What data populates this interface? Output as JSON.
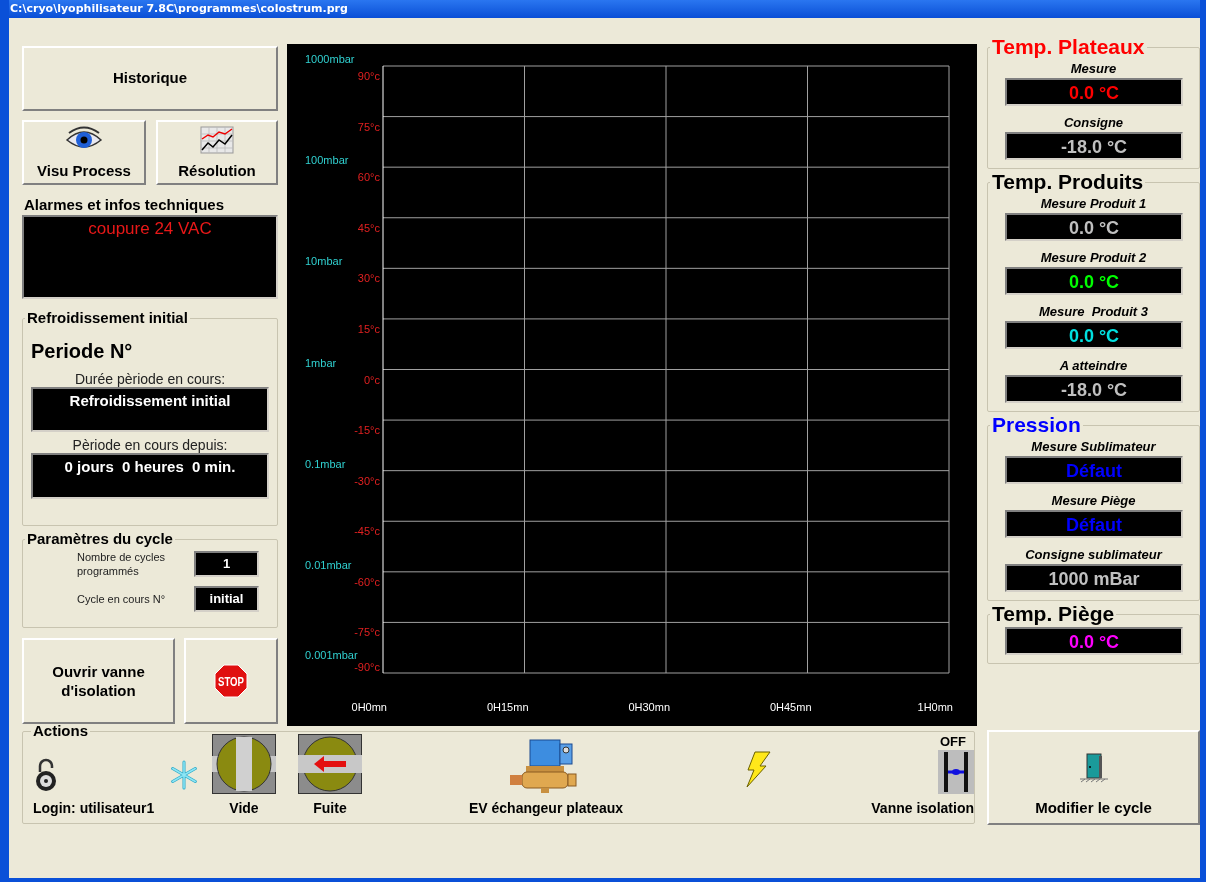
{
  "window": {
    "title": "C:\\cryo\\lyophilisateur 7.8C\\programmes\\colostrum.prg"
  },
  "top_buttons": {
    "history": "Historique",
    "visu_process": "Visu Process",
    "resolution": "Résolution"
  },
  "alarms": {
    "title": "Alarmes et infos techniques",
    "messages": [
      "coupure 24 VAC"
    ]
  },
  "period": {
    "title": "Refroidissement initial",
    "heading": "Periode N°",
    "duration_label": "Durée pèriode en cours:",
    "duration_value": "Refroidissement initial",
    "since_label": "Pèriode en cours depuis:",
    "since_value": "0 jours  0 heures  0 min."
  },
  "cycle_params": {
    "title": "Paramètres du cycle",
    "rows": [
      {
        "label": "Nombre de cycles programmés",
        "value": "1"
      },
      {
        "label": "Cycle en cours N°",
        "value": "initial"
      }
    ]
  },
  "bottom_buttons": {
    "isolation": "Ouvrir vanne d'isolation",
    "stop": "STOP"
  },
  "chart": {
    "temperature_ticks": [
      "90°c",
      "75°c",
      "60°c",
      "45°c",
      "30°c",
      "15°c",
      "0°c",
      "-15°c",
      "-30°c",
      "-45°c",
      "-60°c",
      "-75°c",
      "-90°c"
    ],
    "pressure_ticks": [
      "1000mbar",
      "100mbar",
      "10mbar",
      "1mbar",
      "0.1mbar",
      "0.01mbar",
      "0.001mbar"
    ],
    "time_ticks": [
      "0H0mn",
      "0H15mn",
      "0H30mn",
      "0H45mn",
      "1H0mn"
    ]
  },
  "right_panels": [
    {
      "title": "Temp. Plateaux",
      "color": "#ff0000",
      "readings": [
        {
          "label": "Mesure",
          "value": "0.0 °C",
          "color": "#ff0000"
        },
        {
          "label": "Consigne",
          "value": "-18.0 °C",
          "color": "#c0c0c0"
        }
      ]
    },
    {
      "title": "Temp. Produits",
      "color": "#000000",
      "readings": [
        {
          "label": "Mesure Produit 1",
          "value": "0.0 °C",
          "color": "#c0c0c0"
        },
        {
          "label": "Mesure Produit 2",
          "value": "0.0 °C",
          "color": "#00ff00"
        },
        {
          "label": "Mesure  Produit 3",
          "value": "0.0 °C",
          "color": "#00e0e0"
        },
        {
          "label": "A atteindre",
          "value": "-18.0 °C",
          "color": "#c0c0c0"
        }
      ]
    },
    {
      "title": "Pression",
      "color": "#0000ff",
      "readings": [
        {
          "label": "Mesure Sublimateur",
          "value": "Défaut",
          "color": "#0000ff"
        },
        {
          "label": "Mesure Piège",
          "value": "Défaut",
          "color": "#0000ff"
        },
        {
          "label": "Consigne sublimateur",
          "value": "1000 mBar",
          "color": "#c0c0c0"
        }
      ]
    },
    {
      "title": "Temp. Piège",
      "color": "#000000",
      "readings": [
        {
          "value": "0.0 °C",
          "color": "#ff00ff"
        }
      ]
    }
  ],
  "actions": {
    "title": "Actions",
    "items": [
      {
        "kind": "lock",
        "label": "Login: utilisateur1"
      },
      {
        "kind": "snowflake"
      },
      {
        "kind": "vacuum",
        "label": "Vide"
      },
      {
        "kind": "leak",
        "label": "Fuite"
      },
      {
        "kind": "solenoid",
        "label": "EV échangeur plateaux"
      },
      {
        "kind": "lightning"
      },
      {
        "kind": "isolation",
        "label": "Vanne isolation",
        "status_text": "OFF"
      }
    ]
  },
  "modify_button": "Modifier le cycle"
}
